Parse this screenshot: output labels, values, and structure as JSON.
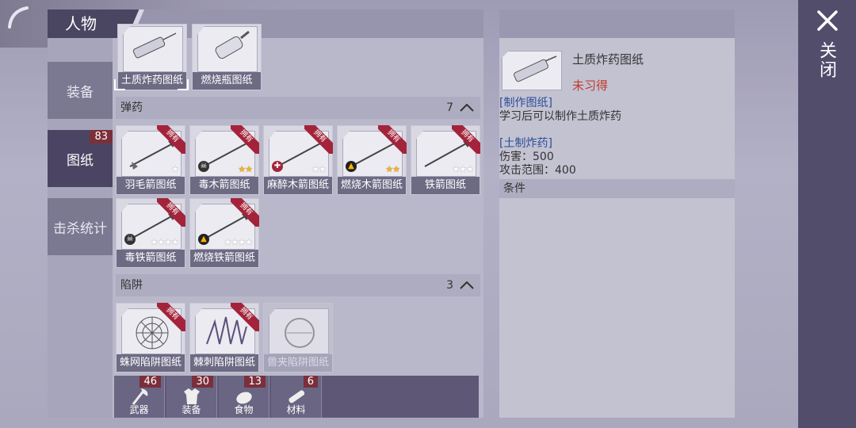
{
  "window_title": "人物",
  "side_tabs": [
    {
      "label": "装备",
      "badge": ""
    },
    {
      "label": "图纸",
      "badge": "83"
    },
    {
      "label": "击杀统计",
      "badge": ""
    }
  ],
  "top_partial_items": [
    {
      "label": "土质炸药图纸",
      "owned": false,
      "selected": true
    },
    {
      "label": "燃烧瓶图纸",
      "owned": false,
      "selected": false
    }
  ],
  "sections": [
    {
      "title": "弹药",
      "count": "7",
      "items": [
        {
          "label": "羽毛箭图纸",
          "ribbon": "拥有",
          "stars": "w1"
        },
        {
          "label": "毒木箭图纸",
          "ribbon": "拥有",
          "stars": "g2"
        },
        {
          "label": "麻醉木箭图纸",
          "ribbon": "拥有",
          "stars": "w2"
        },
        {
          "label": "燃烧木箭图纸",
          "ribbon": "拥有",
          "stars": "g2"
        },
        {
          "label": "铁箭图纸",
          "ribbon": "拥有",
          "stars": "w3"
        },
        {
          "label": "毒铁箭图纸",
          "ribbon": "拥有",
          "stars": "w4"
        },
        {
          "label": "燃烧铁箭图纸",
          "ribbon": "拥有",
          "stars": "w4"
        }
      ]
    },
    {
      "title": "陷阱",
      "count": "3",
      "items": [
        {
          "label": "蛛网陷阱图纸",
          "ribbon": "拥有"
        },
        {
          "label": "棘刺陷阱图纸",
          "ribbon": "拥有"
        },
        {
          "label": "兽夹陷阱图纸",
          "ribbon": ""
        }
      ]
    }
  ],
  "categories": [
    {
      "label": "武器",
      "badge": "46",
      "icon": "axe-icon"
    },
    {
      "label": "装备",
      "badge": "30",
      "icon": "shirt-icon"
    },
    {
      "label": "食物",
      "badge": "13",
      "icon": "meat-icon"
    },
    {
      "label": "材料",
      "badge": "6",
      "icon": "log-icon"
    }
  ],
  "detail": {
    "name": "土质炸药图纸",
    "status": "未习得",
    "status_color": "#c0392b",
    "type_tag": "[制作图纸]",
    "description": "学习后可以制作土质炸药",
    "product_tag": "[土制炸药]",
    "damage": "伤害：500",
    "range": "攻击范围：400",
    "conditions_label": "条件"
  },
  "close_label": "关闭"
}
